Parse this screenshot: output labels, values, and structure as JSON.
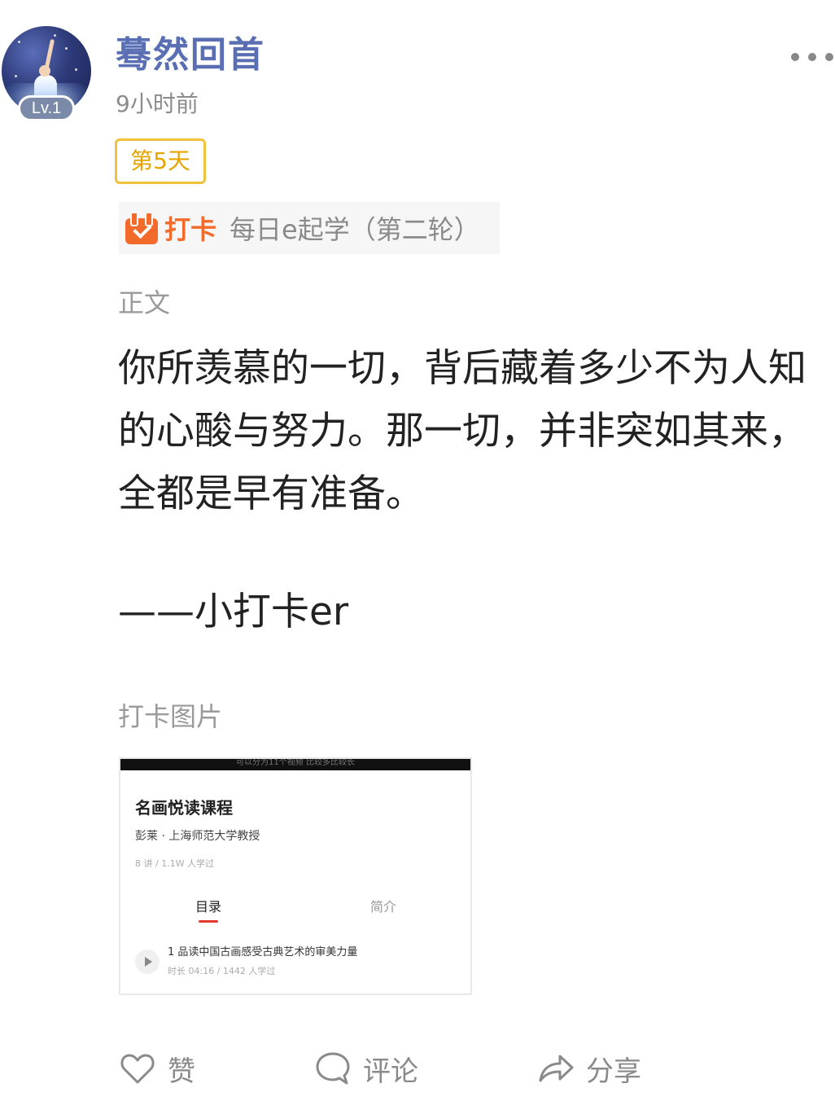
{
  "post": {
    "author": "蓦然回首",
    "level": "Lv.1",
    "time": "9小时前",
    "day_tag": "第5天",
    "checkin": {
      "label": "打卡",
      "course": "每日e起学（第二轮）"
    },
    "body_label": "正文",
    "body_text": "你所羡慕的一切，背后藏着多少不为人知的心酸与努力。那一切，并非突如其来，全都是早有准备。",
    "signature": "——小打卡er",
    "images_label": "打卡图片"
  },
  "thumbnail": {
    "top_caption": "可以分为11个视频 比较多比较长",
    "title": "名画悦读课程",
    "author": "彭莱 · 上海师范大学教授",
    "stats": "8 讲 / 1.1W 人学过",
    "tab_active": "目录",
    "tab_inactive": "简介",
    "lesson_title": "1 品读中国古画感受古典艺术的审美力量",
    "lesson_meta": "时长 04:16 / 1442 人学过"
  },
  "actions": {
    "like": "赞",
    "comment": "评论",
    "share": "分享"
  },
  "icons": {
    "more": "more-dots-icon",
    "calendar": "calendar-check-icon",
    "like": "heart-icon",
    "comment": "speech-bubble-icon",
    "share": "share-arrow-icon"
  },
  "colors": {
    "username": "#5a6fb3",
    "checkin_accent": "#f26b2a",
    "day_tag": "#f0c23c"
  }
}
